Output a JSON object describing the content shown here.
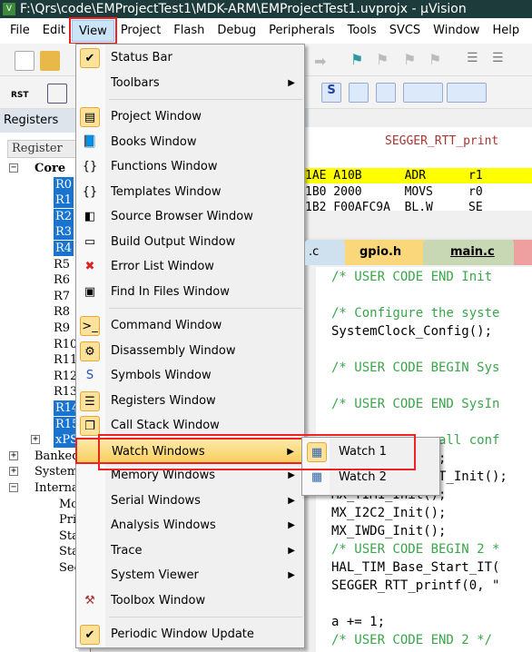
{
  "title": "F:\\Qrs\\code\\EMProjectTest1\\MDK-ARM\\EMProjectTest1.uvprojx - µVision",
  "menubar": [
    "File",
    "Edit",
    "View",
    "Project",
    "Flash",
    "Debug",
    "Peripherals",
    "Tools",
    "SVCS",
    "Window",
    "Help"
  ],
  "active_menu": "View",
  "toolbar": {
    "rst_label": "RST"
  },
  "registers": {
    "header": "Registers",
    "column": "Register",
    "tree": [
      {
        "label": "Core",
        "type": "group"
      },
      {
        "label": "R0",
        "sel": true
      },
      {
        "label": "R1",
        "sel": true
      },
      {
        "label": "R2",
        "sel": true
      },
      {
        "label": "R3",
        "sel": true
      },
      {
        "label": "R4",
        "sel": true
      },
      {
        "label": "R5"
      },
      {
        "label": "R6"
      },
      {
        "label": "R7"
      },
      {
        "label": "R8"
      },
      {
        "label": "R9"
      },
      {
        "label": "R10"
      },
      {
        "label": "R11"
      },
      {
        "label": "R12"
      },
      {
        "label": "R13"
      },
      {
        "label": "R14",
        "sel": true
      },
      {
        "label": "R15",
        "sel": true
      },
      {
        "label": "xPSR",
        "sel": true
      },
      {
        "label": "Banked",
        "type": "group"
      },
      {
        "label": "System",
        "type": "group"
      },
      {
        "label": "Internal",
        "type": "group"
      },
      {
        "label": "Mode"
      },
      {
        "label": "Privilege"
      },
      {
        "label": "Stack"
      },
      {
        "label": "Stack"
      },
      {
        "label": "Sec"
      }
    ]
  },
  "disassembly": {
    "function": "SEGGER_RTT_print",
    "rows": [
      {
        "text": "1AE A10B      ADR      r1",
        "current": true
      },
      {
        "text": "1B0 2000      MOVS     r0"
      },
      {
        "text": "1B2 F00AFC9A  BL.W     SE"
      }
    ]
  },
  "tabs": [
    {
      "label": ".c"
    },
    {
      "label": "gpio.h"
    },
    {
      "label": "main.c",
      "active": true
    },
    {
      "label": ""
    }
  ],
  "code": [
    {
      "t": "/* USER CODE END Init",
      "c": "cm"
    },
    {
      "t": ""
    },
    {
      "t": "/* Configure the syste",
      "c": "cm"
    },
    {
      "t": "SystemClock_Config();"
    },
    {
      "t": ""
    },
    {
      "t": "/* USER CODE BEGIN Sys",
      "c": "cm"
    },
    {
      "t": ""
    },
    {
      "t": "/* USER CODE END SysIn",
      "c": "cm"
    },
    {
      "t": ""
    },
    {
      "t": "            e all conf",
      "c": "cm"
    },
    {
      "t": "            ();"
    },
    {
      "t": "             RT_Init();"
    },
    {
      "t": "MX_TIM1_Init();"
    },
    {
      "t": "MX_I2C2_Init();"
    },
    {
      "t": "MX_IWDG_Init();"
    },
    {
      "t": "/* USER CODE BEGIN 2 *",
      "c": "cm"
    },
    {
      "t": "HAL_TIM_Base_Start_IT("
    },
    {
      "t": "SEGGER_RTT_printf(0, \""
    },
    {
      "t": ""
    },
    {
      "t": "a += 1;"
    },
    {
      "t": "/* USER CODE END 2 */",
      "c": "cm"
    }
  ],
  "view_menu": [
    {
      "label": "Status Bar",
      "icon": "check-icon",
      "checked": true
    },
    {
      "label": "Toolbars",
      "submenu": true
    },
    {
      "sep": true
    },
    {
      "label": "Project Window",
      "icon": "project-window-icon",
      "boxed": true
    },
    {
      "label": "Books Window",
      "icon": "books-icon"
    },
    {
      "label": "Functions Window",
      "icon": "braces-icon"
    },
    {
      "label": "Templates Window",
      "icon": "templates-icon"
    },
    {
      "label": "Source Browser Window",
      "icon": "source-browser-icon"
    },
    {
      "label": "Build Output Window",
      "icon": "build-output-icon"
    },
    {
      "label": "Error List Window",
      "icon": "error-x-icon"
    },
    {
      "label": "Find In Files Window",
      "icon": "find-in-files-icon"
    },
    {
      "sep": true
    },
    {
      "label": "Command Window",
      "icon": "command-icon",
      "boxed": true
    },
    {
      "label": "Disassembly Window",
      "icon": "disassembly-icon",
      "boxed": true
    },
    {
      "label": "Symbols Window",
      "icon": "symbols-icon"
    },
    {
      "label": "Registers Window",
      "icon": "registers-icon",
      "boxed": true
    },
    {
      "label": "Call Stack Window",
      "icon": "call-stack-icon",
      "boxed": true
    },
    {
      "label": "Watch Windows",
      "submenu": true,
      "highlighted": true
    },
    {
      "label": "Memory Windows",
      "submenu": true
    },
    {
      "label": "Serial Windows",
      "submenu": true
    },
    {
      "label": "Analysis Windows",
      "submenu": true
    },
    {
      "label": "Trace",
      "submenu": true
    },
    {
      "label": "System Viewer",
      "submenu": true
    },
    {
      "label": "Toolbox Window",
      "icon": "toolbox-icon"
    },
    {
      "sep": true
    },
    {
      "label": "Periodic Window Update",
      "icon": "check-icon",
      "checked": true
    }
  ],
  "watch_submenu": [
    {
      "label": "Watch 1",
      "icon": "watch-icon",
      "highlighted": true
    },
    {
      "label": "Watch 2",
      "icon": "watch-icon"
    }
  ],
  "colors": {
    "highlight": "#f9cf5e",
    "annotation_red": "#e22222",
    "selection": "#1874d0",
    "pc_line": "#ffff00",
    "comment": "#3aa64a",
    "titlebar": "#1e3b3c"
  }
}
